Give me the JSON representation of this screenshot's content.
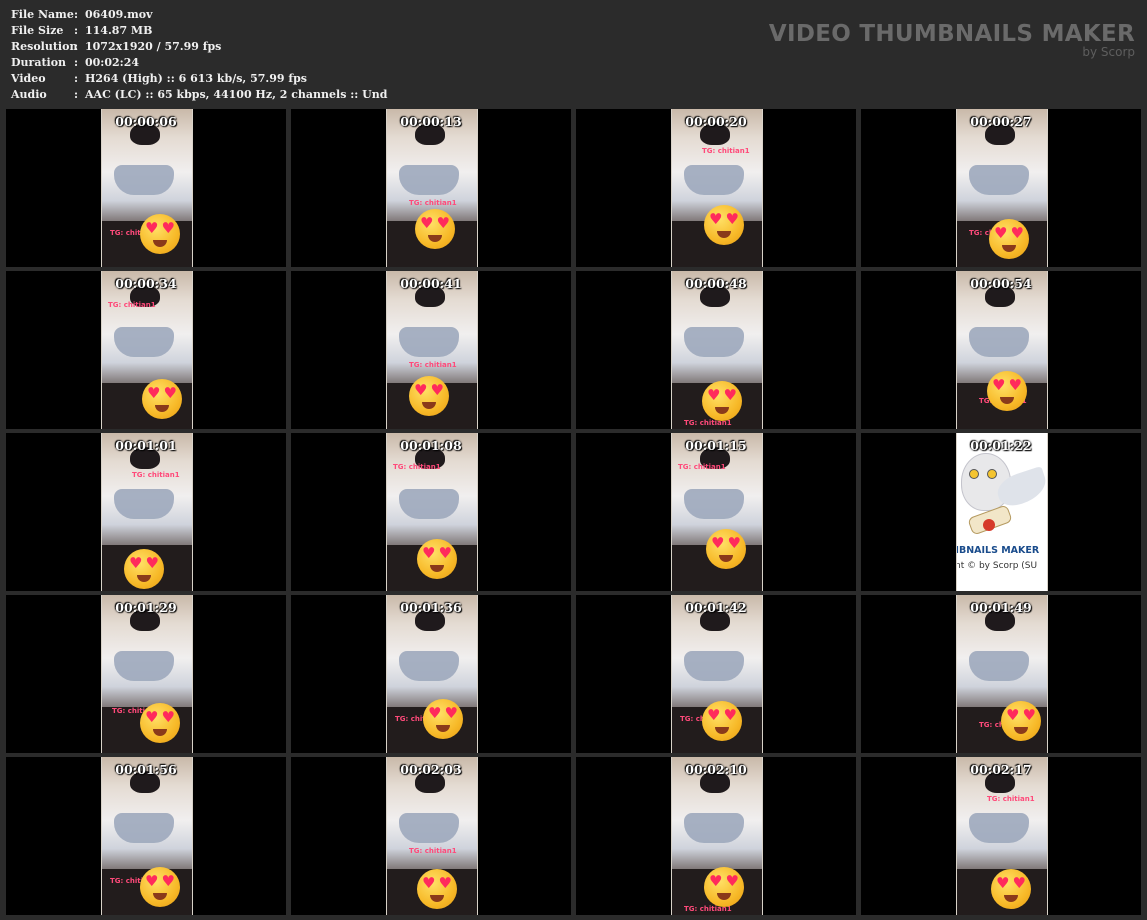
{
  "info": [
    {
      "key": "File Name",
      "sep": ":",
      "value": "06409.mov"
    },
    {
      "key": "File Size",
      "sep": ":",
      "value": "114.87 MB"
    },
    {
      "key": "Resolution",
      "sep": ":",
      "value": "1072x1920 / 57.99 fps"
    },
    {
      "key": "Duration",
      "sep": ":",
      "value": "00:02:24"
    },
    {
      "key": "Video",
      "sep": ":",
      "value": "H264 (High) :: 6 613 kb/s, 57.99 fps"
    },
    {
      "key": "Audio",
      "sep": ":",
      "value": "AAC (LC) :: 65 kbps, 44100 Hz, 2 channels :: Und"
    }
  ],
  "brand": {
    "title": "VIDEO THUMBNAILS MAKER",
    "subtitle": "by Scorp"
  },
  "watermark_text": "TG:  chitian1",
  "logo_frame": {
    "text": "HBNAILS MAKER",
    "copyright": "nt © by Scorp (SU"
  },
  "thumbnails": [
    {
      "time": "00:00:06",
      "wm": 1
    },
    {
      "time": "00:00:13",
      "wm": 2
    },
    {
      "time": "00:00:20",
      "wm": 3
    },
    {
      "time": "00:00:27",
      "wm": 4
    },
    {
      "time": "00:00:34",
      "wm": 0
    },
    {
      "time": "00:00:41",
      "wm": 2
    },
    {
      "time": "00:00:48",
      "wm": 5
    },
    {
      "time": "00:00:54",
      "wm": 6
    },
    {
      "time": "00:01:01",
      "wm": 3
    },
    {
      "time": "00:01:08",
      "wm": 0
    },
    {
      "time": "00:01:15",
      "wm": 0
    },
    {
      "time": "00:01:22",
      "logo": true
    },
    {
      "time": "00:01:29",
      "wm": 7
    },
    {
      "time": "00:01:36",
      "wm": 1
    },
    {
      "time": "00:01:42",
      "wm": 1
    },
    {
      "time": "00:01:49",
      "wm": 6
    },
    {
      "time": "00:01:56",
      "wm": 1
    },
    {
      "time": "00:02:03",
      "wm": 2
    },
    {
      "time": "00:02:10",
      "wm": 5
    },
    {
      "time": "00:02:17",
      "wm": 3
    }
  ],
  "colors": {
    "background": "#2b2b2b",
    "tile": "#000000",
    "watermark": "#ff4a7a",
    "brand_text": "#6a6a6a"
  }
}
